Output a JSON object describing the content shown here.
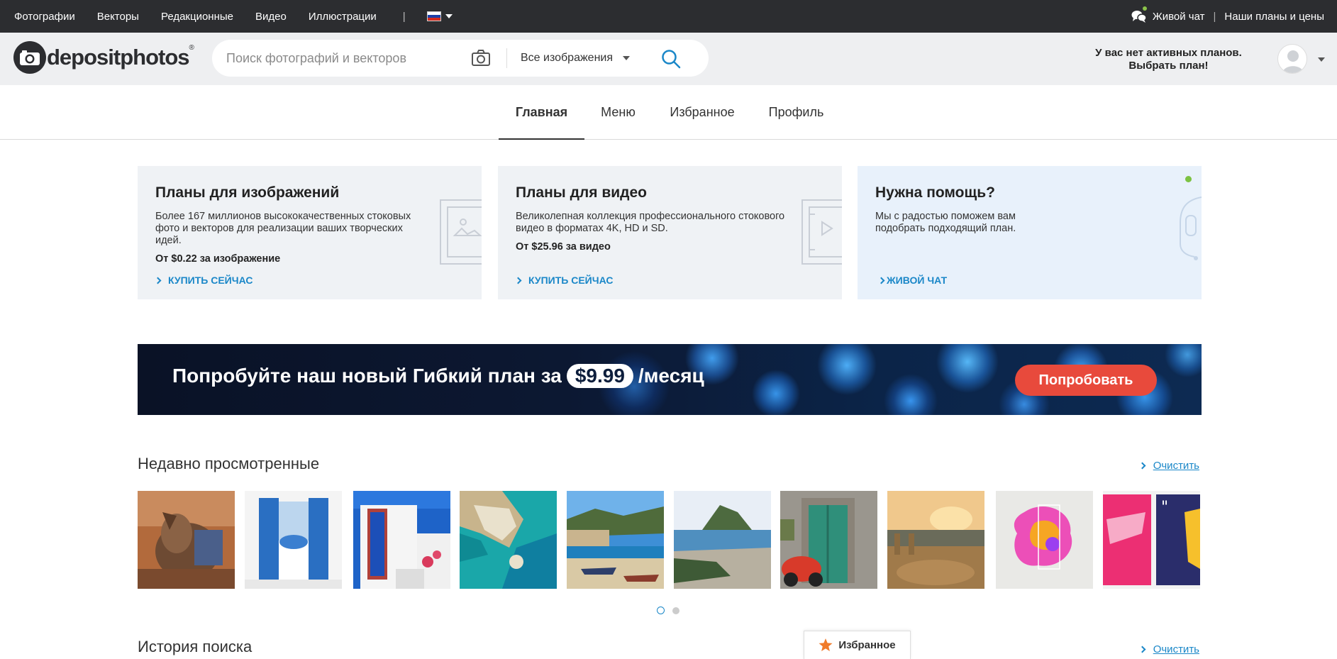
{
  "topbar": {
    "nav": [
      "Фотографии",
      "Векторы",
      "Редакционные",
      "Видео",
      "Иллюстрации"
    ],
    "separator": "|",
    "live_chat": "Живой чат",
    "plans": "Наши планы и цены",
    "language_flag": "russian-flag-icon"
  },
  "header": {
    "logo_text": "depositphotos",
    "logo_reg": "®",
    "search_placeholder": "Поиск фотографий и векторов",
    "search_type": "Все изображения",
    "plan_message_line1": "У вас нет активных планов.",
    "plan_message_line2": "Выбрать план!"
  },
  "tabs": [
    {
      "label": "Главная",
      "active": true
    },
    {
      "label": "Меню",
      "active": false
    },
    {
      "label": "Избранное",
      "active": false
    },
    {
      "label": "Профиль",
      "active": false
    }
  ],
  "cards": [
    {
      "title": "Планы для изображений",
      "description": "Более 167 миллионов высококачественных стоковых фото и векторов для реализации ваших творческих идей.",
      "price": "От $0.22 за изображение",
      "cta": "КУПИТЬ СЕЙЧАС"
    },
    {
      "title": "Планы для видео",
      "description": "Великолепная коллекция профессионального стокового видео в форматах 4K, HD и SD.",
      "price": "От $25.96 за видео",
      "cta": "КУПИТЬ СЕЙЧАС"
    },
    {
      "title": "Нужна помощь?",
      "description": "Мы с радостью поможем вам подобрать подходящий план.",
      "price": "",
      "cta": "ЖИВОЙ ЧАТ"
    }
  ],
  "banner": {
    "text_before": "Попробуйте наш новый Гибкий план за",
    "price": "$9.99",
    "text_after": "/месяц",
    "button": "Попробовать"
  },
  "recent": {
    "title": "Недавно просмотренные",
    "clear": "Очистить",
    "thumbnails": [
      "donkey-photo",
      "blue-window-photo",
      "blue-door-photo",
      "aerial-coast-photo",
      "beach-boats-photo",
      "island-photo",
      "green-door-scooter-photo",
      "ancient-theatre-photo",
      "paint-splash-photo",
      "pink-poster-photo"
    ],
    "page": 1,
    "pages": 2
  },
  "search_history": {
    "title": "История поиска",
    "clear": "Очистить"
  },
  "favorites_tab": "Избранное",
  "colors": {
    "accent": "#1a87c8",
    "topbar": "#2c2d30",
    "cta_button": "#e84a3c",
    "online": "#7cc242"
  }
}
